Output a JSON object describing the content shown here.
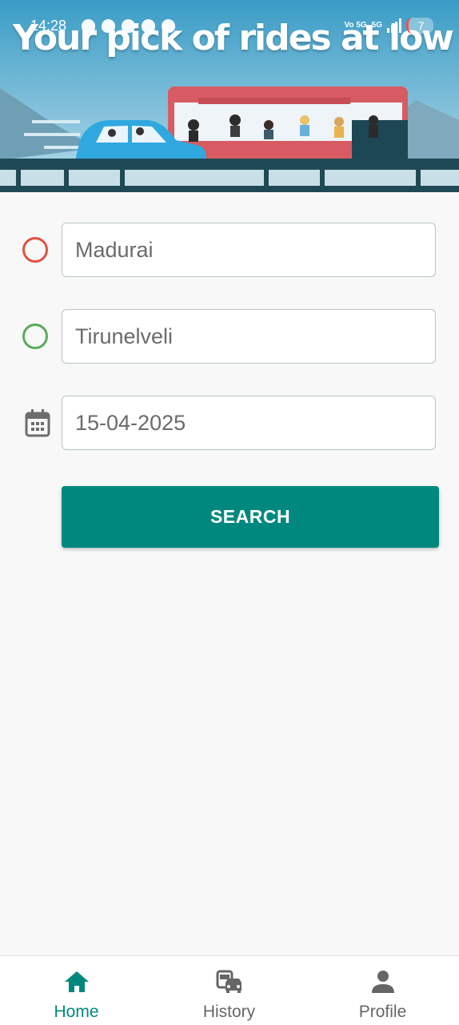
{
  "status_bar": {
    "time": "14:28",
    "network_label": "Vo 5G",
    "net_5g": "5G",
    "battery": "7"
  },
  "banner": {
    "title": "Your pick of rides at low prices"
  },
  "search_form": {
    "from_value": "Madurai",
    "to_value": "Tirunelveli",
    "date_value": "15-04-2025",
    "search_label": "SEARCH"
  },
  "bottom_nav": {
    "items": [
      {
        "label": "Home",
        "icon": "home-icon",
        "active": true
      },
      {
        "label": "History",
        "icon": "history-bus-car-icon",
        "active": false
      },
      {
        "label": "Profile",
        "icon": "person-icon",
        "active": false
      }
    ]
  },
  "colors": {
    "accent": "#00887f",
    "from_ring": "#e0513f",
    "to_ring": "#5aab5a",
    "banner_sky": "#3fa3c8"
  }
}
